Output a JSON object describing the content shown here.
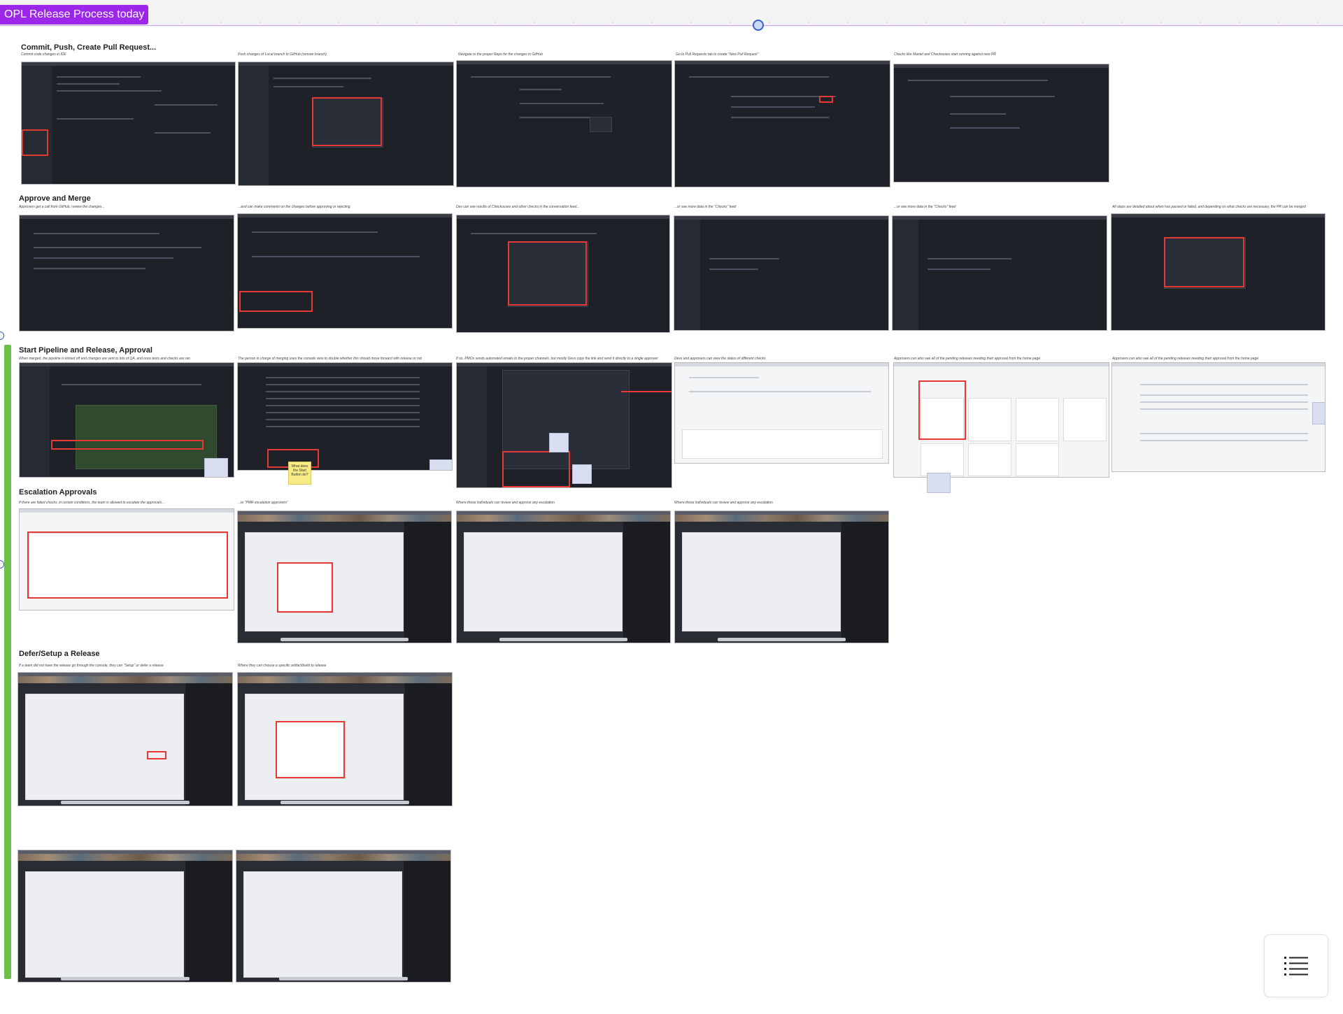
{
  "board": {
    "frame_title": "OPL Release Process today"
  },
  "sections": [
    {
      "title": "Commit, Push, Create Pull Request...",
      "captions": [
        "Commit code changes in IDE",
        "Push changes of Local branch to GitHub (remote branch)",
        "Navigate to the proper Repo for the changes in GitHub",
        "Go to Pull Requests tab to create \"New Pull Request\"",
        "Checks like Maniel and Checkouses start running against new PR"
      ]
    },
    {
      "title": "Approve and Merge",
      "captions": [
        "Approvers get a call from GitHub, review the changes...",
        "...and can make comments on the changes before approving or rejecting",
        "Dev can see results of Checkouses and other checks in the conversation feed...",
        "...or see more data in the \"Checks\" feed",
        "...or see more data in the \"Checks\" feed",
        "All steps are detailed about when has passed or failed, and depending on what checks are necessary, the PR can be merged"
      ]
    },
    {
      "title": "Start Pipeline and Release, Approval",
      "captions": [
        "When merged, the pipeline is kicked off and changes are sent to lots of QA, and once tests and checks are ran",
        "The person in charge of merging uses the console view to double whether this should move forward with release or not",
        "If so, PMOs sends automated emails to the proper channels, but mostly Devs copy the link and send it directly to a single approver",
        "Devs and approvers can view the status of different checks",
        "Approvers can also see all of the pending releases needing their approval from the home page",
        "Approvers can also see all of the pending releases needing their approval from the home page"
      ],
      "sticky_text": "What does the Start Button do?"
    },
    {
      "title": "Escalation Approvals",
      "captions": [
        "If there are failed checks, in certain conditions, the team is allowed to escalate the approvals...",
        "...to \"PMR escalation approvers\"",
        "Where those individuals can review and approve any escalation",
        "Where those individuals can review and approve any escalation"
      ]
    },
    {
      "title": "Defer/Setup a Release",
      "captions": [
        "If a team did not have the release go through the console, they can \"Setup\" or defer a release",
        "Where they can choose a specific artifact/build to release"
      ]
    }
  ],
  "controls": {
    "menu_icon": "list-icon"
  }
}
